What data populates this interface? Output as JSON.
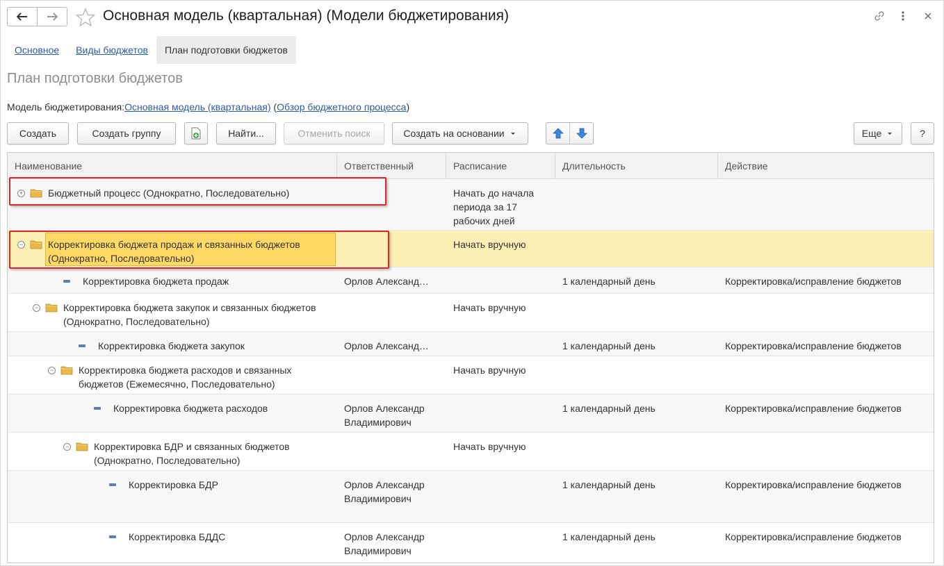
{
  "window": {
    "title": "Основная модель (квартальная) (Модели бюджетирования)"
  },
  "tabs": [
    {
      "label": "Основное"
    },
    {
      "label": "Виды бюджетов"
    },
    {
      "label": "План подготовки бюджетов"
    }
  ],
  "page": {
    "heading": "План подготовки бюджетов",
    "model_label": "Модель бюджетирования:",
    "model_link": "Основная модель (квартальная)",
    "overview_open": "(",
    "overview_link": "Обзор бюджетного процесса",
    "overview_close": ")"
  },
  "toolbar": {
    "create": "Создать",
    "create_group": "Создать группу",
    "find": "Найти...",
    "cancel_search": "Отменить поиск",
    "create_based": "Создать на основании",
    "more": "Еще",
    "help": "?"
  },
  "table": {
    "columns": [
      "Наименование",
      "Ответственный",
      "Расписание",
      "Длительность",
      "Действие"
    ],
    "rows": [
      {
        "name": "Бюджетный процесс (Однократно, Последовательно)",
        "responsible": "",
        "schedule": "Начать до начала периода за 17 рабочих дней",
        "duration": "",
        "action": "",
        "type": "group",
        "state": "collapsed",
        "level": 0
      },
      {
        "name": "Корректировка бюджета продаж и связанных бюджетов (Однократно, Последовательно)",
        "responsible": "",
        "schedule": "Начать вручную",
        "duration": "",
        "action": "",
        "type": "group",
        "state": "expanded",
        "level": 0,
        "selected": true
      },
      {
        "name": "Корректировка бюджета продаж",
        "responsible": "Орлов Александ…",
        "schedule": "",
        "duration": "1 календарный день",
        "action": "Корректировка/исправление бюджетов",
        "type": "item",
        "level": 1
      },
      {
        "name": "Корректировка бюджета закупок и связанных бюджетов (Однократно, Последовательно)",
        "responsible": "",
        "schedule": "Начать вручную",
        "duration": "",
        "action": "",
        "type": "group",
        "state": "expanded",
        "level": 1
      },
      {
        "name": "Корректировка бюджета закупок",
        "responsible": "Орлов Александ…",
        "schedule": "",
        "duration": "1 календарный день",
        "action": "Корректировка/исправление бюджетов",
        "type": "item",
        "level": 2
      },
      {
        "name": "Корректировка бюджета расходов и связанных бюджетов (Ежемесячно, Последовательно)",
        "responsible": "",
        "schedule": "Начать вручную",
        "duration": "",
        "action": "",
        "type": "group",
        "state": "expanded",
        "level": 2
      },
      {
        "name": "Корректировка бюджета расходов",
        "responsible": "Орлов Александр Владимирович",
        "schedule": "",
        "duration": "1 календарный день",
        "action": "Корректировка/исправление бюджетов",
        "type": "item",
        "level": 3
      },
      {
        "name": "Корректировка БДР и связанных бюджетов (Однократно, Последовательно)",
        "responsible": "",
        "schedule": "Начать вручную",
        "duration": "",
        "action": "",
        "type": "group",
        "state": "expanded",
        "level": 3
      },
      {
        "name": "Корректировка БДР",
        "responsible": "Орлов Александр Владимирович",
        "schedule": "",
        "duration": "1 календарный день",
        "action": "Корректировка/исправление бюджетов",
        "type": "item",
        "level": 4
      },
      {
        "name": "Корректировка БДДС",
        "responsible": "Орлов Александр Владимирович",
        "schedule": "",
        "duration": "1 календарный день",
        "action": "Корректировка/исправление бюджетов",
        "type": "item",
        "level": 4
      }
    ]
  },
  "colors": {
    "link": "#2a5da8",
    "selection": "#fbefb4",
    "highlight_border": "#d8282b",
    "folder": "#e8b84a"
  }
}
